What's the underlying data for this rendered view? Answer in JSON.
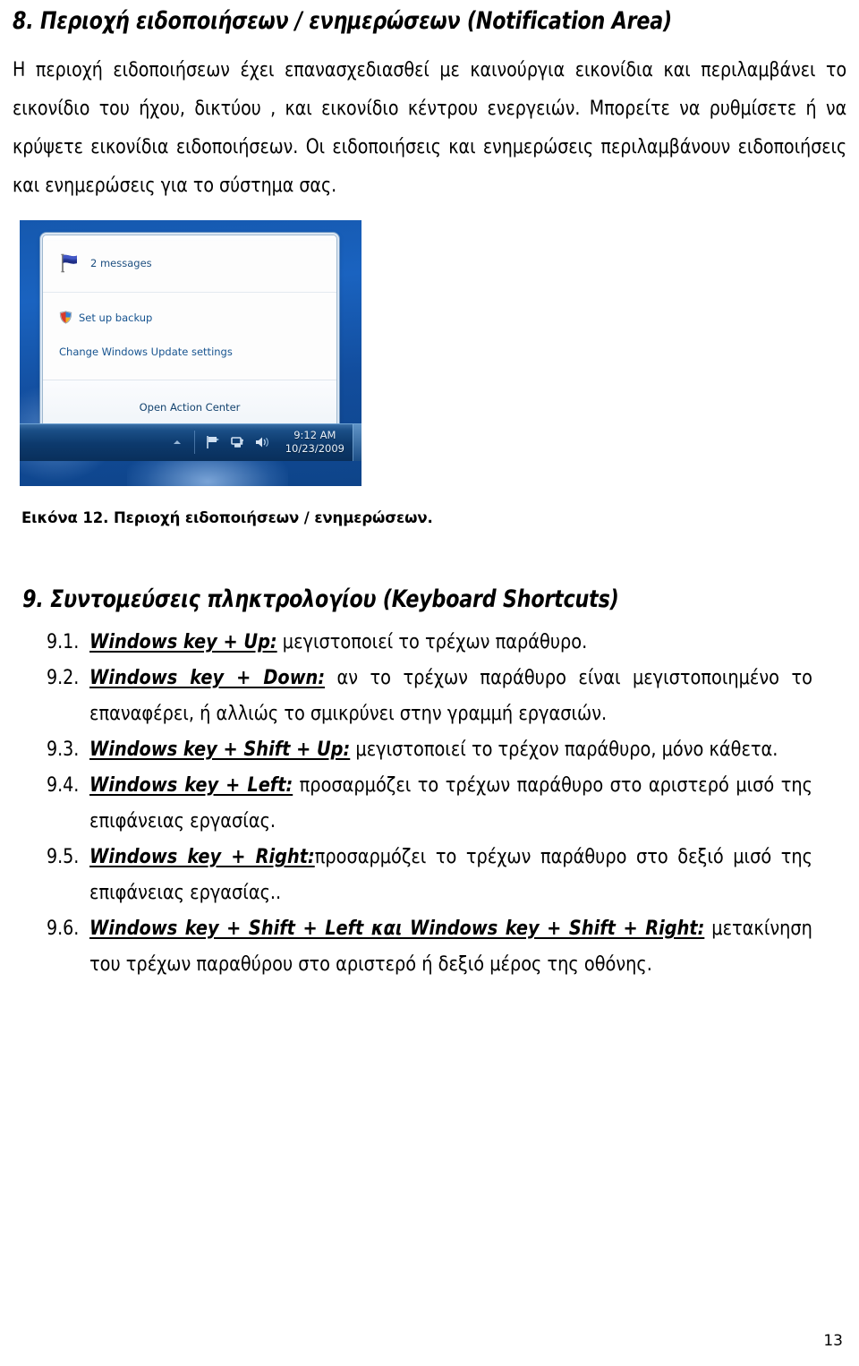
{
  "document": {
    "page_number": "13"
  },
  "section8": {
    "heading": "8. Περιοχή ειδοποιήσεων / ενημερώσεων (Notification Area)",
    "paragraph": "Η περιοχή ειδοποιήσεων έχει επανασχεδιασθεί με καινούργια εικονίδια και περιλαμβάνει το εικονίδιο του ήχου, δικτύου , και εικονίδιο κέντρου ενεργειών. Μπορείτε να ρυθμίσετε ή να κρύψετε εικονίδια ειδοποιήσεων. Οι ειδοποιήσεις και ενημερώσεις περιλαμβάνουν ειδοποιήσεις και ενημερώσεις για το σύστημα σας."
  },
  "figure": {
    "caption": "Εικόνα 12. Περιοχή ειδοποιήσεων / ενημερώσεων.",
    "screenshot": {
      "messages_label": "2 messages",
      "backup_label": "Set up backup",
      "windows_update_label": "Change Windows Update settings",
      "action_center_label": "Open Action Center",
      "taskbar": {
        "time": "9:12 AM",
        "date": "10/23/2009"
      }
    }
  },
  "section9": {
    "heading": "9. Συντομεύσεις πληκτρολογίου (Keyboard Shortcuts)",
    "items": [
      {
        "number": "9.1.",
        "shortcut": "Windows key + Up:",
        "description": " μεγιστοποιεί το τρέχων παράθυρο.",
        "justify": false
      },
      {
        "number": "9.2.",
        "shortcut": "Windows key + Down:",
        "description": " αν το τρέχων παράθυρο είναι μεγιστοποιημένο το επαναφέρει, ή αλλιώς το σμικρύνει στην γραμμή εργασιών.",
        "justify": true
      },
      {
        "number": "9.3.",
        "shortcut": "Windows key + Shift + Up:",
        "description": " μεγιστοποιεί το τρέχον παράθυρο, μόνο κάθετα.",
        "justify": false
      },
      {
        "number": "9.4.",
        "shortcut": "Windows key + Left:",
        "description": " προσαρμόζει το τρέχων παράθυρο στο αριστερό μισό της επιφάνειας εργασίας.",
        "justify": true
      },
      {
        "number": "9.5.",
        "shortcut": "Windows key + Right:",
        "description": "προσαρμόζει το τρέχων παράθυρο στο δεξιό μισό της επιφάνειας εργασίας..",
        "justify": true
      },
      {
        "number": "9.6.",
        "shortcut": "Windows key + Shift + Left και Windows key + Shift + Right:",
        "description": " μετακίνηση του τρέχων παραθύρου στο αριστερό ή δεξιό μέρος της οθόνης.",
        "justify": true
      }
    ]
  },
  "colors": {
    "taskbar_blue": "#1b4f87",
    "desktop_blue": "#1558ae",
    "link_blue": "#16538f"
  }
}
